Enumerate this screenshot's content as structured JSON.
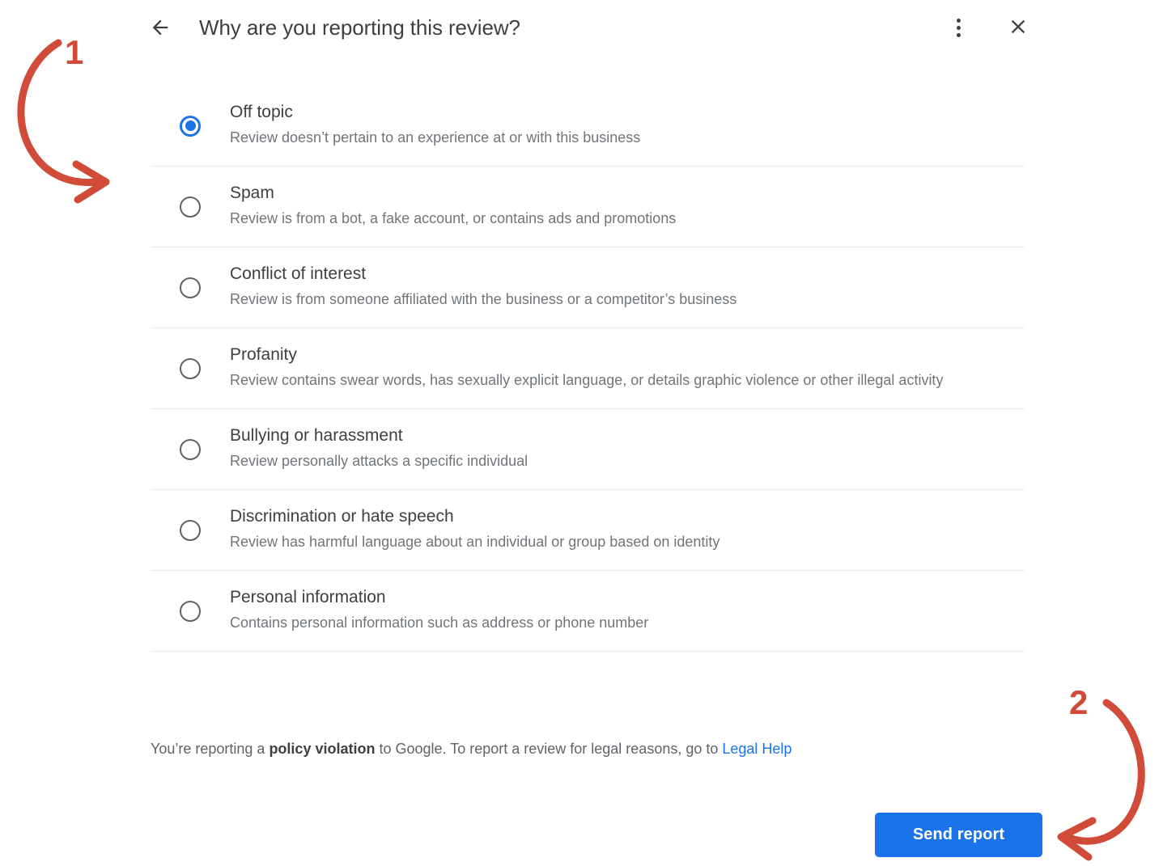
{
  "header": {
    "title": "Why are you reporting this review?",
    "back_icon": "arrow-left-icon",
    "menu_icon": "more-vert-icon",
    "close_icon": "close-icon"
  },
  "colors": {
    "accent_blue": "#1a73e8",
    "annotation_red": "#d14b38",
    "title_text": "#3c4043",
    "desc_text": "#70757a",
    "divider": "#e8eaed"
  },
  "options": [
    {
      "id": "off-topic",
      "title": "Off topic",
      "desc": "Review doesn’t pertain to an experience at or with this business",
      "selected": true
    },
    {
      "id": "spam",
      "title": "Spam",
      "desc": "Review is from a bot, a fake account, or contains ads and promotions",
      "selected": false
    },
    {
      "id": "conflict-of-interest",
      "title": "Conflict of interest",
      "desc": "Review is from someone affiliated with the business or a competitor’s business",
      "selected": false
    },
    {
      "id": "profanity",
      "title": "Profanity",
      "desc": "Review contains swear words, has sexually explicit language, or details graphic violence or other illegal activity",
      "selected": false
    },
    {
      "id": "bullying-or-harassment",
      "title": "Bullying or harassment",
      "desc": "Review personally attacks a specific individual",
      "selected": false
    },
    {
      "id": "discrimination-or-hate-speech",
      "title": "Discrimination or hate speech",
      "desc": "Review has harmful language about an individual or group based on identity",
      "selected": false
    },
    {
      "id": "personal-information",
      "title": "Personal information",
      "desc": "Contains personal information such as address or phone number",
      "selected": false
    }
  ],
  "footer": {
    "text_before": "You’re reporting a ",
    "emphasis": "policy violation",
    "text_middle": " to Google. To report a review for legal reasons, go to ",
    "link_label": "Legal Help"
  },
  "actions": {
    "send_report_label": "Send report"
  },
  "annotations": [
    {
      "id": "annotation-1",
      "number": "1",
      "shape": "curved-arrow-right"
    },
    {
      "id": "annotation-2",
      "number": "2",
      "shape": "curved-arrow-left"
    }
  ]
}
